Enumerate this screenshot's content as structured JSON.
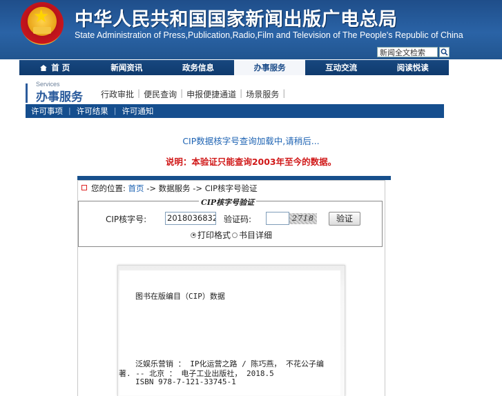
{
  "header": {
    "title_cn": "中华人民共和国国家新闻出版广电总局",
    "title_en": "State Administration of Press,Publication,Radio,Film and Television of The People's Republic of China",
    "search_placeholder": "新闻全文检索"
  },
  "nav": {
    "items": [
      {
        "label": "首 页"
      },
      {
        "label": "新闻资讯"
      },
      {
        "label": "政务信息"
      },
      {
        "label": "办事服务"
      },
      {
        "label": "互动交流"
      },
      {
        "label": "阅读悦读"
      }
    ],
    "active": "办事服务"
  },
  "services": {
    "small_label": "Services",
    "title": "办事服务",
    "subnav": [
      "行政审批",
      "便民查询",
      "申报便捷通道",
      "场景服务"
    ],
    "bluebar": [
      "许可事项",
      "许可结果",
      "许可通知"
    ]
  },
  "main": {
    "loading_text": "CIP数据核字号查询加载中,请稍后...",
    "note_text": "说明：本验证只能查询2003年至今的数据。"
  },
  "breadcrumb": {
    "prefix": "您的位置:",
    "home": "首页",
    "rest": "-> 数据服务 -> CIP核字号验证"
  },
  "form": {
    "legend": "CIP核字号验证",
    "cip_label": "CIP核字号:",
    "cip_value": "2018036832",
    "code_label": "验证码:",
    "code_value": "",
    "captcha_text": "2718",
    "verify_button": "验证",
    "radio_print": "打印格式",
    "radio_detail": "书目详细",
    "selected_radio": "打印格式"
  },
  "card": {
    "heading": "图书在版编目（CIP）数据",
    "line1": "泛娱乐营销 ： IP化运营之路 / 陈巧燕， 不花公子编",
    "line2": "著. -- 北京 ： 电子工业出版社， 2018.5",
    "line3": "ISBN 978-7-121-33745-1"
  },
  "colors": {
    "banner_blue": "#2a63a6",
    "nav_blue": "#0f3a6d",
    "link_blue": "#1e63b3",
    "note_red": "#d01818"
  }
}
